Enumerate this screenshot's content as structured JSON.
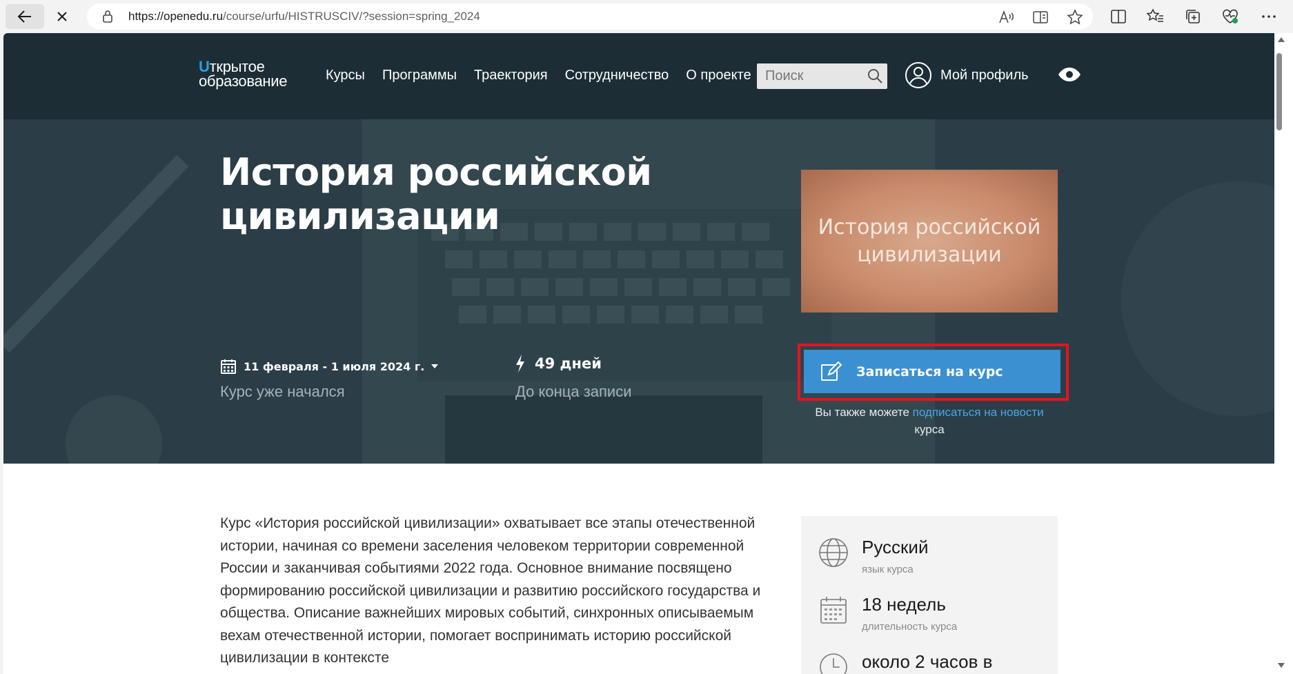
{
  "browser": {
    "url_host": "https://openedu.ru",
    "url_path": "/course/urfu/HISTRUSCIV/?session=spring_2024"
  },
  "header": {
    "logo_line1": "ткрытое",
    "logo_line2": "образование",
    "nav": [
      "Курсы",
      "Программы",
      "Траектория",
      "Сотрудничество",
      "О проекте"
    ],
    "search_placeholder": "Поиск",
    "profile_label": "Мой профиль"
  },
  "hero": {
    "title": "История российской цивилизации",
    "image_text": "История российской цивилизации",
    "dates": "11 февраля - 1 июля 2024 г.",
    "dates_status": "Курс уже начался",
    "days_left": "49 дней",
    "days_label": "До конца записи",
    "enroll_label": "Записаться на курс",
    "subscribe_prefix": "Вы также можете",
    "subscribe_link": "подписаться на новости",
    "subscribe_suffix": "курса"
  },
  "description": "Курс «История российской цивилизации» охватывает все этапы отечественной истории, начиная со времени заселения человеком территории современной России и заканчивая событиями 2022 года. Основное внимание посвящено формированию российской цивилизации и развитию российского государства и общества. Описание важнейших мировых событий, синхронных описываемым вехам отечественной истории, помогает воспринимать историю российской цивилизации в контексте",
  "info": {
    "language": "Русский",
    "language_label": "язык курса",
    "duration": "18 недель",
    "duration_label": "длительность курса",
    "effort": "около 2 часов в"
  },
  "colors": {
    "header_bg": "#1c2d36",
    "hero_bg": "#2b3e47",
    "accent": "#3b90d1",
    "highlight": "#e3141e",
    "link": "#49a6e6"
  }
}
